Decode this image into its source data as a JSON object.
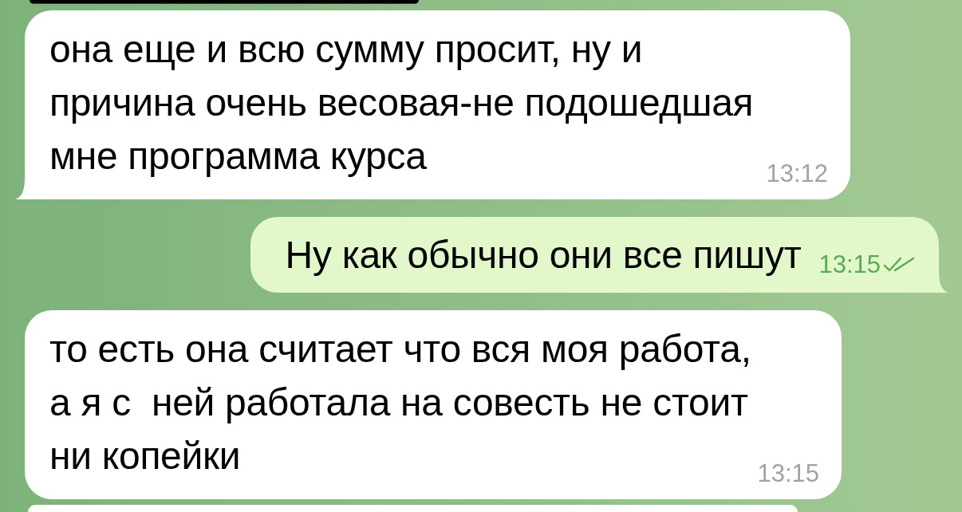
{
  "chat": {
    "messages": [
      {
        "kind": "cut_off_top"
      },
      {
        "kind": "incoming",
        "text": "она еще и всю сумму просит, ну и причина очень весовая-не подошедшая мне программа курса",
        "time": "13:12",
        "tail": true
      },
      {
        "kind": "outgoing",
        "text": "Ну как обычно они все пишут",
        "time": "13:15",
        "read": true,
        "tail": true
      },
      {
        "kind": "incoming",
        "text": "то есть она считает что вся моя работа, а я с  ней работала на совесть не стоит ни копейки",
        "time": "13:15",
        "tail": false
      },
      {
        "kind": "cut_off_bottom"
      }
    ]
  }
}
